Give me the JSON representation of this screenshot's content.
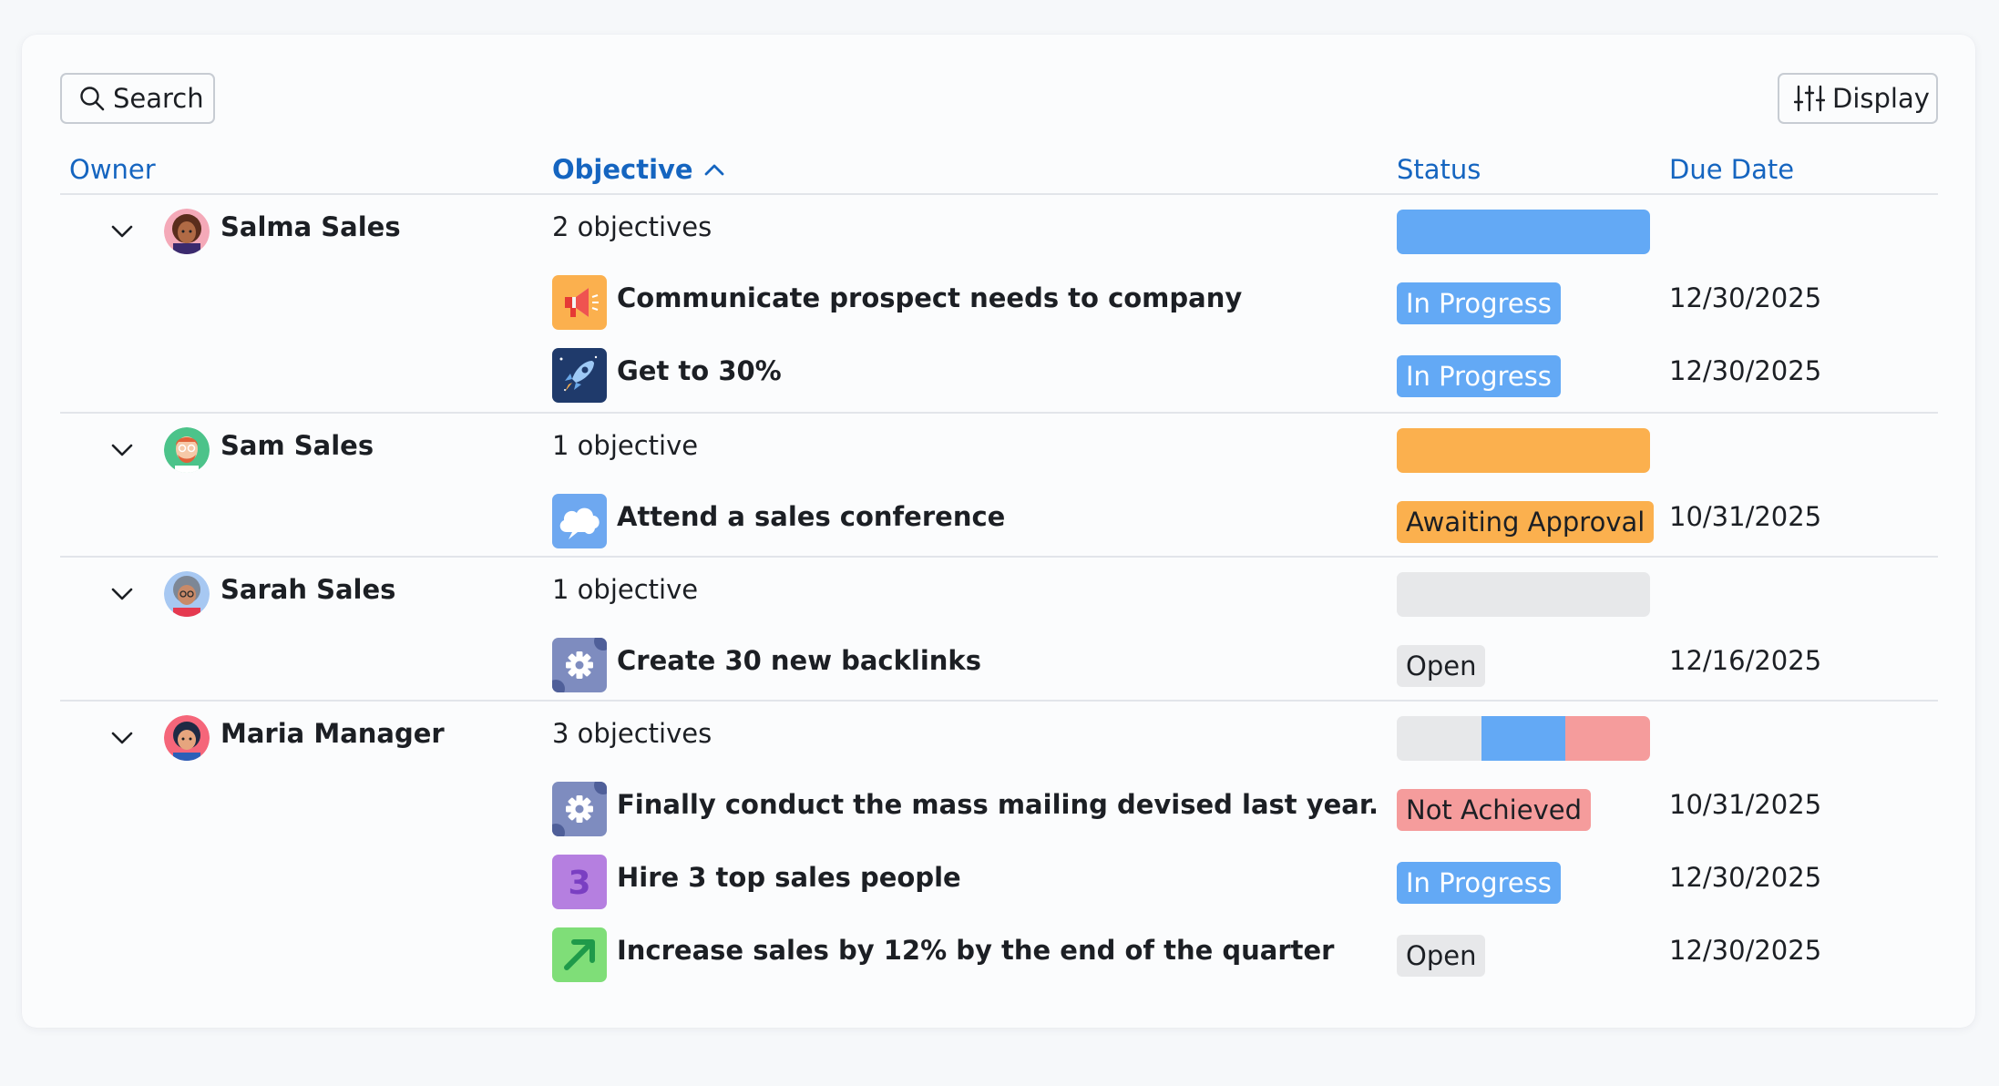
{
  "toolbar": {
    "search_label": "Search",
    "display_label": "Display"
  },
  "columns": {
    "owner": "Owner",
    "objective": "Objective",
    "status": "Status",
    "due_date": "Due Date"
  },
  "colors": {
    "in_progress": "#63a9f5",
    "awaiting_approval": "#fbb04e",
    "open": "#e7e8ea",
    "not_achieved": "#f59c9c",
    "header_link": "#1565c0"
  },
  "groups": [
    {
      "owner": "Salma Sales",
      "count": "2 objectives",
      "objectives": [
        {
          "title": "Communicate prospect needs to company",
          "status": "In Progress",
          "due": "12/30/2025",
          "icon": "megaphone-icon"
        },
        {
          "title": "Get to 30%",
          "status": "In Progress",
          "due": "12/30/2025",
          "icon": "rocket-icon"
        }
      ]
    },
    {
      "owner": "Sam Sales",
      "count": "1 objective",
      "objectives": [
        {
          "title": "Attend a sales conference",
          "status": "Awaiting Approval",
          "due": "10/31/2025",
          "icon": "cloud-icon"
        }
      ]
    },
    {
      "owner": "Sarah Sales",
      "count": "1 objective",
      "objectives": [
        {
          "title": "Create 30 new backlinks",
          "status": "Open",
          "due": "12/16/2025",
          "icon": "gear-icon"
        }
      ]
    },
    {
      "owner": "Maria Manager",
      "count": "3 objectives",
      "objectives": [
        {
          "title": "Finally conduct the mass mailing devised last year.",
          "status": "Not Achieved",
          "due": "10/31/2025",
          "icon": "gear-icon"
        },
        {
          "title": "Hire 3 top sales people",
          "status": "In Progress",
          "due": "12/30/2025",
          "icon": "number-three-icon"
        },
        {
          "title": "Increase sales by 12% by the end of the quarter",
          "status": "Open",
          "due": "12/30/2025",
          "icon": "arrow-up-right-icon"
        }
      ]
    }
  ]
}
